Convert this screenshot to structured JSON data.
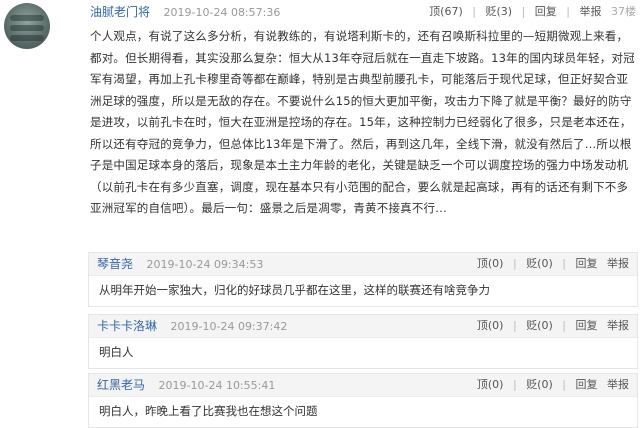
{
  "post": {
    "username": "油腻老门将",
    "time": "2019-10-24 08:57:36",
    "actions": {
      "up": "顶(67)",
      "down": "贬(3)",
      "reply": "回复",
      "report": "举报",
      "views": "37楼"
    },
    "body": "个人观点，有说了这么多分析，有说教练的，有说塔利斯卡的，还有召唤斯科拉里的—短期微观上来看，都对。但长期得看，其实没那么复杂：恒大从13年夺冠后就在一直走下坡路。13年的国内球员年轻，对冠军有渴望，再加上孔卡穆里奇等都在巅峰，特别是古典型前腰孔卡，可能落后于现代足球，但正好契合亚洲足球的强度，所以是无敌的存在。不要说什么15的恒大更加平衡，攻击力下降了就是平衡？最好的防守是进攻，以前孔卡在时，恒大在亚洲是控场的存在。15年，这种控制力已经弱化了很多，只是老本还在，所以还有夺冠的竞争力，但总体比13年是下滑了。然后，再到这几年，全线下滑，就没有然后了…所以根子是中国足球本身的落后，现象是本土主力年龄的老化，关键是缺乏一个可以调度控场的强力中场发动机（以前孔卡在有多少直塞，调度，现在基本只有小范围的配合，要么就是起高球，再有的话还有剩下不多亚洲冠军的自信吧）。最后一句：盛景之后是凋零，青黄不接真不行…"
  },
  "replies": [
    {
      "username": "琴音尧",
      "time": "2019-10-24 09:34:53",
      "actions": {
        "up": "顶(0)",
        "down": "贬(0)",
        "reply": "回复",
        "report": "举报"
      },
      "text": "从明年开始一家独大，归化的好球员几乎都在这里，这样的联赛还有啥竞争力"
    },
    {
      "username": "卡卡卡洛琳",
      "time": "2019-10-24 09:37:42",
      "actions": {
        "up": "顶(0)",
        "down": "贬(0)",
        "reply": "回复",
        "report": "举报"
      },
      "text": "明白人"
    },
    {
      "username": "红黑老马",
      "time": "2019-10-24 10:55:41",
      "actions": {
        "up": "顶(0)",
        "down": "贬(0)",
        "reply": "回复",
        "report": "举报"
      },
      "text": "明白人，昨晚上看了比赛我也在想这个问题"
    }
  ]
}
